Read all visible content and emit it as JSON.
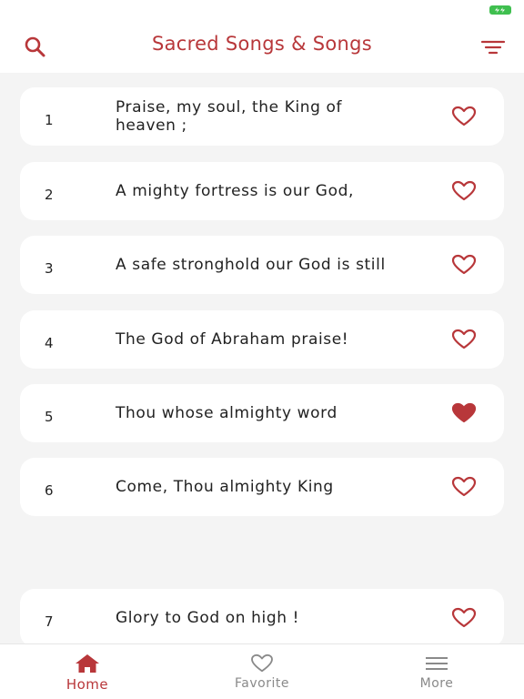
{
  "header": {
    "title": "Sacred Songs & Songs",
    "search_icon": "search-icon",
    "filter_icon": "filter-icon"
  },
  "colors": {
    "accent": "#b8373a",
    "background": "#f4f4f4",
    "card": "#ffffff",
    "battery": "#3fbf4f"
  },
  "songs": [
    {
      "number": "1",
      "title": "Praise, my soul, the King of heaven ;",
      "favorite": false
    },
    {
      "number": "2",
      "title": "A mighty fortress is our God,",
      "favorite": false
    },
    {
      "number": "3",
      "title": "A safe stronghold our God is still",
      "favorite": false
    },
    {
      "number": "4",
      "title": "The God of Abraham praise!",
      "favorite": false
    },
    {
      "number": "5",
      "title": "Thou whose almighty word",
      "favorite": true
    },
    {
      "number": "6",
      "title": "Come, Thou almighty King",
      "favorite": false
    },
    {
      "number": "7",
      "title": "Glory to God on high !",
      "favorite": false
    }
  ],
  "tabs": [
    {
      "label": "Home",
      "icon": "home-icon",
      "active": true
    },
    {
      "label": "Favorite",
      "icon": "heart-outline-icon",
      "active": false
    },
    {
      "label": "More",
      "icon": "menu-icon",
      "active": false
    }
  ]
}
